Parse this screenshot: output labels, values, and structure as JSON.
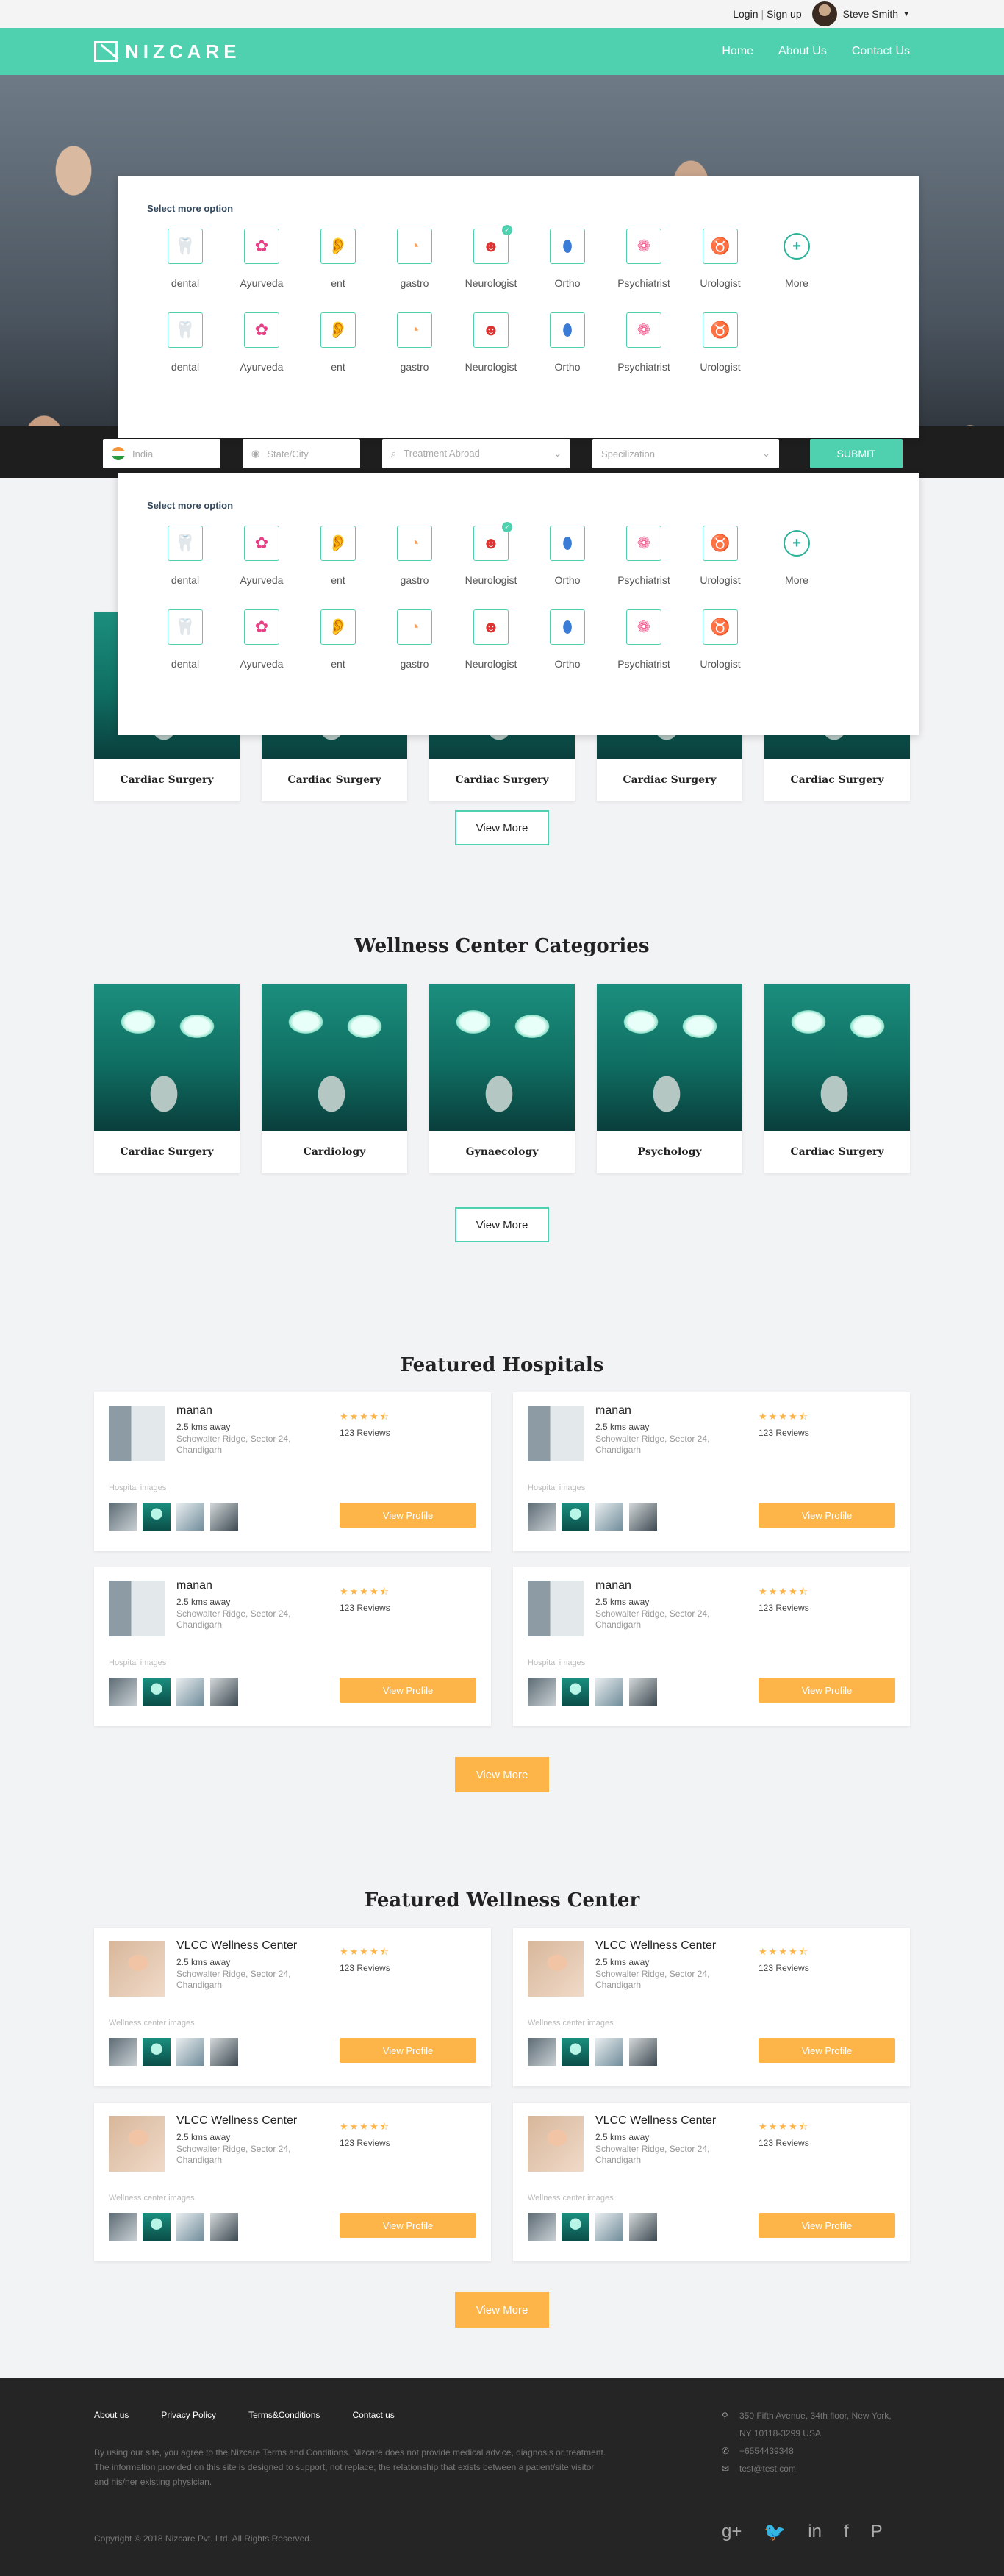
{
  "topbar": {
    "login": "Login",
    "signup": "Sign up",
    "user": "Steve Smith"
  },
  "brand": {
    "logo": "NIZCARE"
  },
  "nav": [
    "Home",
    "About Us",
    "Contact Us"
  ],
  "option_menu": {
    "heading": "Select more option",
    "row1": [
      {
        "label": "dental",
        "icon": "tooth-icon"
      },
      {
        "label": "Ayurveda",
        "icon": "flower-icon"
      },
      {
        "label": "ent",
        "icon": "ear-icon"
      },
      {
        "label": "gastro",
        "icon": "stomach-icon"
      },
      {
        "label": "Neurologist",
        "icon": "brain-head-icon",
        "selected": true
      },
      {
        "label": "Ortho",
        "icon": "bone-icon"
      },
      {
        "label": "Psychiatrist",
        "icon": "brain-icon"
      },
      {
        "label": "Urologist",
        "icon": "kidney-icon"
      },
      {
        "label": "More",
        "icon": "plus-icon"
      }
    ],
    "row2": [
      {
        "label": "dental",
        "icon": "tooth-icon"
      },
      {
        "label": "Ayurveda",
        "icon": "flower-icon"
      },
      {
        "label": "ent",
        "icon": "ear-icon"
      },
      {
        "label": "gastro",
        "icon": "stomach-icon"
      },
      {
        "label": "Neurologist",
        "icon": "brain-head-icon"
      },
      {
        "label": "Ortho",
        "icon": "bone-icon"
      },
      {
        "label": "Psychiatrist",
        "icon": "brain-icon"
      },
      {
        "label": "Urologist",
        "icon": "kidney-icon"
      }
    ]
  },
  "search": {
    "country": "India",
    "city_placeholder": "State/City",
    "treatment_placeholder": "Treatment Abroad",
    "speciality_placeholder": "Specilization",
    "submit": "SUBMIT"
  },
  "specialities": {
    "cards": [
      "Cardiac Surgery",
      "Cardiac Surgery",
      "Cardiac Surgery",
      "Cardiac Surgery",
      "Cardiac Surgery"
    ],
    "button": "View More"
  },
  "wellness_categories": {
    "title": "Wellness Center Categories",
    "cards": [
      "Cardiac Surgery",
      "Cardiology",
      "Gynaecology",
      "Psychology",
      "Cardiac Surgery"
    ],
    "button": "View More"
  },
  "featured_hospitals": {
    "title": "Featured Hospitals",
    "items": [
      {
        "name": "manan",
        "distance": "2.5 kms away",
        "address": "Schowalter Ridge, Sector 24, Chandigarh",
        "stars": "★★★★⯪",
        "reviews": "123 Reviews",
        "gallery_label": "Hospital images",
        "button": "View Profile"
      },
      {
        "name": "manan",
        "distance": "2.5 kms away",
        "address": "Schowalter Ridge, Sector 24, Chandigarh",
        "stars": "★★★★⯪",
        "reviews": "123 Reviews",
        "gallery_label": "Hospital images",
        "button": "View Profile"
      },
      {
        "name": "manan",
        "distance": "2.5 kms away",
        "address": "Schowalter Ridge, Sector 24, Chandigarh",
        "stars": "★★★★⯪",
        "reviews": "123 Reviews",
        "gallery_label": "Hospital images",
        "button": "View Profile"
      },
      {
        "name": "manan",
        "distance": "2.5 kms away",
        "address": "Schowalter Ridge, Sector 24, Chandigarh",
        "stars": "★★★★⯪",
        "reviews": "123 Reviews",
        "gallery_label": "Hospital images",
        "button": "View Profile"
      }
    ],
    "button": "View More"
  },
  "featured_wellness": {
    "title": "Featured Wellness Center",
    "items": [
      {
        "name": "VLCC Wellness Center",
        "distance": "2.5 kms away",
        "address": "Schowalter Ridge, Sector 24, Chandigarh",
        "stars": "★★★★⯪",
        "reviews": "123 Reviews",
        "gallery_label": "Wellness center images",
        "button": "View Profile"
      },
      {
        "name": "VLCC Wellness Center",
        "distance": "2.5 kms away",
        "address": "Schowalter Ridge, Sector 24, Chandigarh",
        "stars": "★★★★⯪",
        "reviews": "123 Reviews",
        "gallery_label": "Wellness center images",
        "button": "View Profile"
      },
      {
        "name": "VLCC Wellness Center",
        "distance": "2.5 kms away",
        "address": "Schowalter Ridge, Sector 24, Chandigarh",
        "stars": "★★★★⯪",
        "reviews": "123 Reviews",
        "gallery_label": "Wellness center images",
        "button": "View Profile"
      },
      {
        "name": "VLCC Wellness Center",
        "distance": "2.5 kms away",
        "address": "Schowalter Ridge, Sector 24, Chandigarh",
        "stars": "★★★★⯪",
        "reviews": "123 Reviews",
        "gallery_label": "Wellness center images",
        "button": "View Profile"
      }
    ],
    "button": "View More"
  },
  "footer": {
    "links": [
      "About us",
      "Privacy Policy",
      "Terms&Conditions",
      "Contact us"
    ],
    "disclaimer": "By using our site, you agree to the Nizcare Terms and Conditions. Nizcare does not provide medical advice, diagnosis or treatment. The information provided on this site is designed to support, not replace, the relationship that exists between a patient/site visitor and his/her existing physician.",
    "copyright": "Copyright © 2018 Nizcare Pvt. Ltd. All Rights Reserved.",
    "address_line1": "350 Fifth Avenue, 34th floor, New York,",
    "address_line2": "NY 10118-3299 USA",
    "phone": "+6554439348",
    "email": "test@test.com"
  },
  "colors": {
    "brand": "#4fd1b0",
    "accent": "#fdb549",
    "footer": "#252525"
  }
}
